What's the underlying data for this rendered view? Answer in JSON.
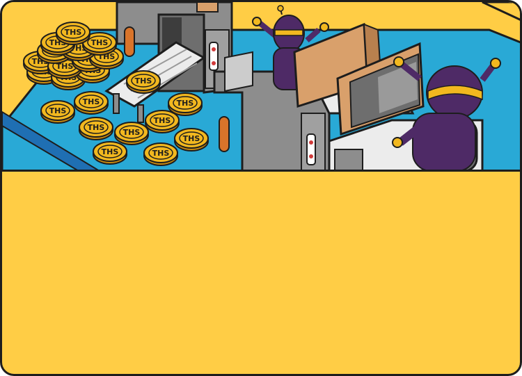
{
  "card": {
    "coin_label": "THS",
    "colors": {
      "background": "#ffcd45",
      "floor": "#29a9d6",
      "outline": "#1d1d1d",
      "coin": "#f2b81f",
      "robot": "#4e2a66",
      "machine": "#8d8d8d",
      "monitor_back": "#d9a06b",
      "panel": "#ffcd45"
    },
    "icons": [
      "coin-icon",
      "robot-icon",
      "monitor-icon",
      "conveyor-icon",
      "keyboard-icon",
      "mouse-icon"
    ]
  }
}
